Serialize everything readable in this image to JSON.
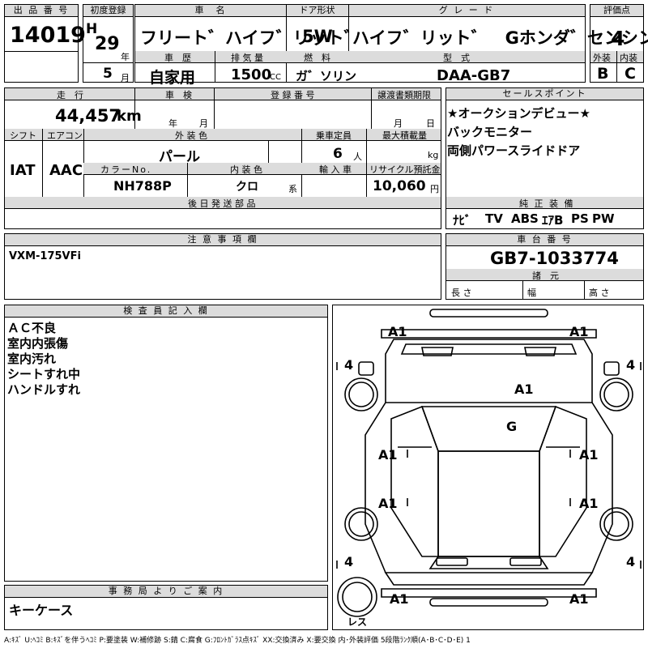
{
  "top": {
    "lot_no_label": "出 品 番 号",
    "lot_no": "14019",
    "first_reg_label": "初度登録",
    "era": "H",
    "year": "29",
    "year_unit": "年",
    "month": "5",
    "month_unit": "月",
    "car_name_label": "車　名",
    "car_name": "フリート゛ハイフ゛リット゛",
    "door_label": "ドア形状",
    "door": "5W",
    "grade_label": "グ レ ー ド",
    "grade": "ハイフ゛リット゛　Gホンダ゛センシング",
    "score_label": "評価点",
    "score": "4",
    "history_label": "車　歴",
    "history": "自家用",
    "displacement_label": "排 気 量",
    "displacement": "1500",
    "displacement_unit": "CC",
    "fuel_label": "燃　料",
    "fuel": "ガ゛ソリン",
    "model_label": "型　式",
    "model": "DAA-GB7",
    "exterior_label": "外装",
    "exterior": "B",
    "interior_label": "内装",
    "interior": "C"
  },
  "row2": {
    "mileage_label": "走　行",
    "mileage": "44,457",
    "mileage_unit": "km",
    "inspection_label": "車　検",
    "inspection_year_unit": "年",
    "inspection_month_unit": "月",
    "reg_no_label": "登 録 番 号",
    "transfer_label": "譲渡書類期限",
    "transfer_month_unit": "月",
    "transfer_day_unit": "日",
    "shift_label": "シフト",
    "shift": "IAT",
    "ac_label": "エアコン",
    "ac": "AAC",
    "color_label": "外 装 色",
    "color": "パール",
    "capacity_label": "乗車定員",
    "capacity": "6",
    "capacity_unit": "人",
    "max_load_label": "最大積載量",
    "max_load_unit": "kg",
    "color_no_label": "カラーNo.",
    "color_no": "NH788P",
    "int_color_label": "内 装 色",
    "int_color": "クロ",
    "int_color_unit": "系",
    "import_label": "輸 入 車",
    "recycle_label": "リサイクル預託金",
    "recycle": "10,060",
    "recycle_unit": "円",
    "parts_label": "後 日 発 送 部 品"
  },
  "sales_points": {
    "label": "セールスポイント",
    "lines": [
      "★オークションデビュー★",
      "バックモニター",
      "両側パワースライドドア"
    ]
  },
  "equipment": {
    "label": "純 正 装 備",
    "items": [
      "ﾅﾋﾞ",
      "TV",
      "ABS",
      "ｴｱB",
      "PS",
      "PW"
    ]
  },
  "notes": {
    "label": "注 意 事 項 欄",
    "text": "VXM-175VFi"
  },
  "chassis": {
    "label": "車 台 番 号",
    "value": "GB7-1033774",
    "dims_label": "諸　元",
    "length_label": "長 さ",
    "width_label": "幅",
    "height_label": "高 さ"
  },
  "inspector": {
    "label": "検 査 員 記 入 欄",
    "lines": [
      "ＡＣ不良",
      "室内内張傷",
      "室内汚れ",
      "シートすれ中",
      "ハンドルすれ"
    ]
  },
  "office": {
    "label": "事 務 局 よ り ご 案 内",
    "text": "キーケース"
  },
  "diagram": {
    "marks": {
      "a1_tl": "A1",
      "a1_tr": "A1",
      "a1_hood": "A1",
      "g_windshield": "G",
      "a1_ml1": "A1",
      "a1_mr1": "A1",
      "a1_ml2": "A1",
      "a1_mr2": "A1",
      "a1_bl": "A1",
      "a1_br": "A1"
    },
    "tire_fl": "4",
    "tire_fr": "4",
    "tire_rl": "4",
    "tire_rr": "4",
    "spare": "レス"
  },
  "legend": "A:ｷｽﾞ  U:ﾍｺﾐ  B:ｷｽﾞを伴うﾍｺﾐ  P:要塗装  W:補修跡  S:錆  C:腐食  G:ﾌﾛﾝﾄｶﾞﾗｽ点ｷｽﾞ  XX:交換済み  X:要交換  内･外装評価  5段階ﾗﾝｸ順(A･B･C･D･E)  1"
}
